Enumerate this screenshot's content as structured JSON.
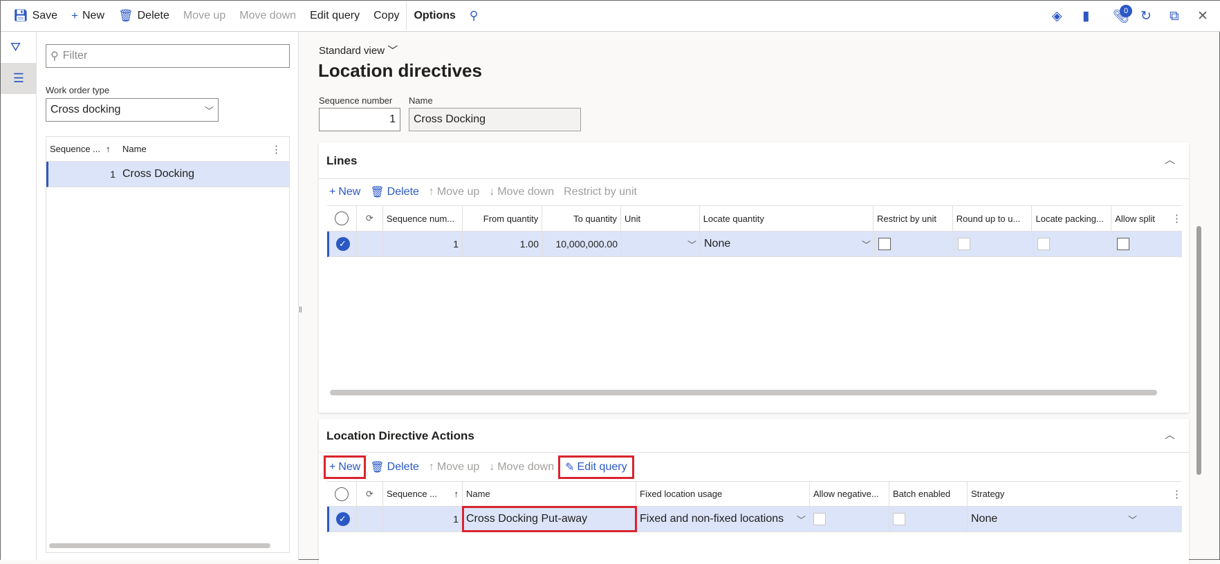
{
  "toolbar": {
    "save": "Save",
    "new": "New",
    "delete": "Delete",
    "move_up": "Move up",
    "move_down": "Move down",
    "edit_query": "Edit query",
    "copy": "Copy",
    "options": "Options",
    "notification_count": "0"
  },
  "left": {
    "filter_placeholder": "Filter",
    "work_order_type_label": "Work order type",
    "work_order_type_value": "Cross docking",
    "grid_headers": [
      "Sequence ...",
      "Name"
    ],
    "rows": [
      {
        "seq": "1",
        "name": "Cross Docking"
      }
    ]
  },
  "main": {
    "view": "Standard view",
    "title": "Location directives",
    "seq_label": "Sequence number",
    "seq_value": "1",
    "name_label": "Name",
    "name_value": "Cross Docking"
  },
  "lines": {
    "title": "Lines",
    "toolbar": {
      "new": "New",
      "delete": "Delete",
      "move_up": "Move up",
      "move_down": "Move down",
      "restrict": "Restrict by unit"
    },
    "headers": [
      "Sequence num...",
      "From quantity",
      "To quantity",
      "Unit",
      "Locate quantity",
      "Restrict by unit",
      "Round up to u...",
      "Locate packing...",
      "Allow split"
    ],
    "row": {
      "seq": "1",
      "from": "1.00",
      "to": "10,000,000.00",
      "unit": "",
      "locate": "None"
    }
  },
  "actions": {
    "title": "Location Directive Actions",
    "toolbar": {
      "new": "New",
      "delete": "Delete",
      "move_up": "Move up",
      "move_down": "Move down",
      "edit_query": "Edit query"
    },
    "headers": [
      "Sequence ...",
      "Name",
      "Fixed location usage",
      "Allow negative...",
      "Batch enabled",
      "Strategy"
    ],
    "row": {
      "seq": "1",
      "name": "Cross Docking Put-away",
      "usage": "Fixed and non-fixed locations",
      "strategy": "None"
    }
  },
  "colors": {
    "accent": "#2b58c4",
    "highlight": "#d9232d",
    "selected_row": "#dbe4f8"
  }
}
